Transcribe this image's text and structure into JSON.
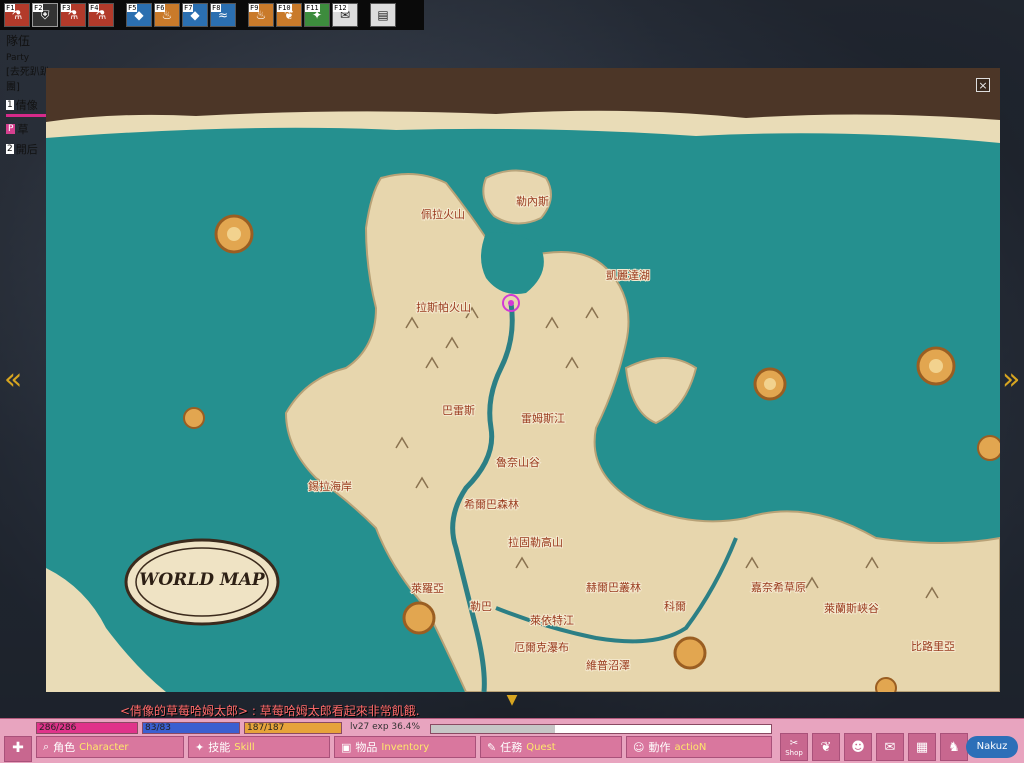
{
  "hotbar": {
    "groups": [
      [
        {
          "key": "F1",
          "icon": "potion-icon",
          "color": "red"
        },
        {
          "key": "F2",
          "icon": "shield-icon",
          "color": "dark"
        },
        {
          "key": "F3",
          "icon": "potion-icon",
          "color": "red"
        },
        {
          "key": "F4",
          "icon": "potion-icon",
          "color": "red"
        }
      ],
      [
        {
          "key": "F5",
          "icon": "blue-gem-icon",
          "color": "blue"
        },
        {
          "key": "F6",
          "icon": "fire-icon",
          "color": "orange"
        },
        {
          "key": "F7",
          "icon": "blue-gem-icon",
          "color": "blue"
        },
        {
          "key": "F8",
          "icon": "fish-icon",
          "color": "blue"
        }
      ],
      [
        {
          "key": "F9",
          "icon": "fire-icon",
          "color": "orange"
        },
        {
          "key": "F10",
          "icon": "leaf-icon",
          "color": "orange"
        },
        {
          "key": "F11",
          "icon": "skill-icon",
          "color": "green"
        },
        {
          "key": "F12",
          "icon": "scroll-icon",
          "color": "white"
        }
      ]
    ],
    "options_icon": "options-icon"
  },
  "party": {
    "title": "隊伍",
    "title_en": "Party",
    "guild": "[去死趴趴團]",
    "members": [
      {
        "num": "1",
        "name": "倩像"
      },
      {
        "tag": "P",
        "name": "草"
      },
      {
        "num": "2",
        "name": "開后"
      }
    ]
  },
  "map": {
    "logo": "WORLD MAP",
    "close_icon": "close-icon",
    "labels": [
      {
        "text": "勒內斯"
      },
      {
        "text": "佩拉火山"
      },
      {
        "text": "凱麗達湖"
      },
      {
        "text": "拉斯帕火山"
      },
      {
        "text": "巴雷斯"
      },
      {
        "text": "雷姆斯江"
      },
      {
        "text": "魯奈山谷"
      },
      {
        "text": "錫拉海岸"
      },
      {
        "text": "希爾巴森林"
      },
      {
        "text": "拉固勒高山"
      },
      {
        "text": "萊羅亞"
      },
      {
        "text": "赫爾巴叢林"
      },
      {
        "text": "嘉奈希草原"
      },
      {
        "text": "勒巴"
      },
      {
        "text": "科爾"
      },
      {
        "text": "萊蘭斯峽谷"
      },
      {
        "text": "萊依特江"
      },
      {
        "text": "厄爾克瀑布"
      },
      {
        "text": "比路里亞"
      },
      {
        "text": "維普沼澤"
      }
    ]
  },
  "chat": {
    "line": "<倩像的草莓哈姆太郎> : 草莓哈姆太郎看起來非常飢餓."
  },
  "status": {
    "hp": "286/286",
    "hp_ratio": 1.0,
    "sp": "83/83",
    "sp_ratio": 1.0,
    "weight": "187/187",
    "weight_ratio": 1.0,
    "level_exp": "lv27 exp 36.4%",
    "exp_ratio": 0.364
  },
  "menu": [
    {
      "zh": "角色",
      "en": "Character",
      "icon": "search-icon"
    },
    {
      "zh": "技能",
      "en": "Skill",
      "icon": "skill-icon"
    },
    {
      "zh": "物品",
      "en": "Inventory",
      "icon": "item-icon"
    },
    {
      "zh": "任務",
      "en": "Quest",
      "icon": "quest-icon"
    },
    {
      "zh": "動作",
      "en": "actioN",
      "icon": "action-icon"
    }
  ],
  "right_icons": [
    {
      "label": "Shop",
      "icon": "shop-icon"
    },
    {
      "label": "",
      "icon": "wings-icon"
    },
    {
      "label": "",
      "icon": "friends-icon"
    },
    {
      "label": "",
      "icon": "chat-icon"
    },
    {
      "label": "",
      "icon": "map-icon"
    },
    {
      "label": "",
      "icon": "pet-icon"
    }
  ],
  "brand": "Nakuz"
}
